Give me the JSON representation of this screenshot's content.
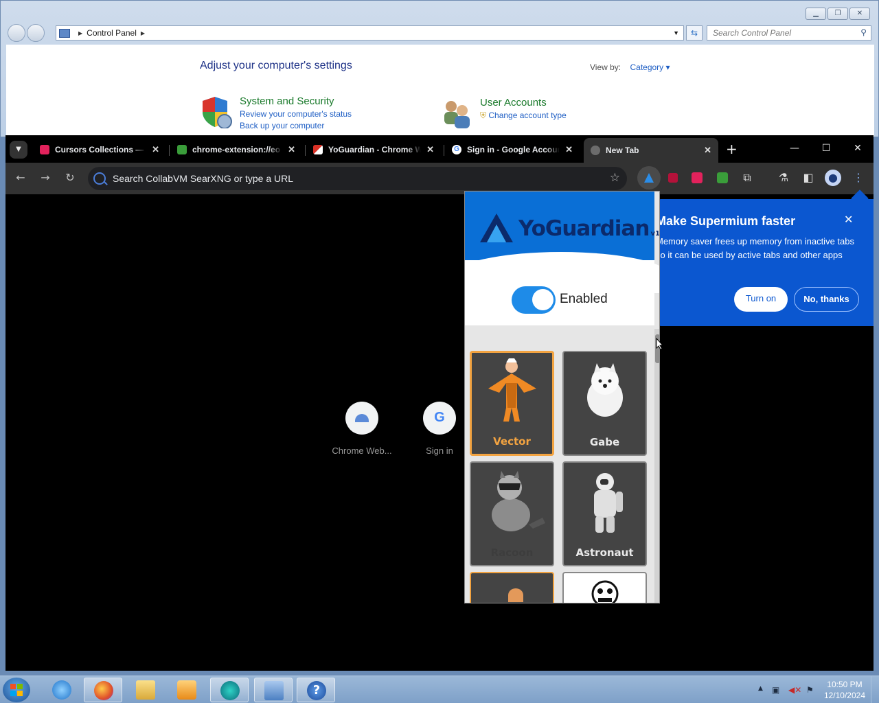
{
  "control_panel": {
    "breadcrumb": "Control Panel",
    "search_placeholder": "Search Control Panel",
    "heading": "Adjust your computer's settings",
    "view_by_label": "View by:",
    "view_by_value": "Category",
    "categories": [
      {
        "title": "System and Security",
        "links": [
          "Review your computer's status",
          "Back up your computer"
        ]
      },
      {
        "title": "User Accounts",
        "links": [
          "Change account type"
        ]
      }
    ]
  },
  "browser": {
    "tabs": [
      {
        "label": "Cursors Collections — C",
        "favicon_color": "#e2225c"
      },
      {
        "label": "chrome-extension://eo",
        "favicon_color": "#3a9d3a"
      },
      {
        "label": "YoGuardian - Chrome W",
        "favicon_color": "#d93025"
      },
      {
        "label": "Sign in - Google Accoun",
        "favicon_color": "#4285f4"
      },
      {
        "label": "New Tab",
        "favicon_color": "#6c6c6c",
        "active": true
      }
    ],
    "omnibox_placeholder": "Search CollabVM SearXNG or type a URL",
    "shortcuts": [
      {
        "name": "Chrome Web..."
      },
      {
        "name": "Sign in"
      }
    ]
  },
  "yoguardian": {
    "logo": "YoGuardian",
    "version": "v1",
    "toggle_label": "Enabled",
    "toggle_on": true,
    "cursors": [
      {
        "name": "Vector",
        "selected": true
      },
      {
        "name": "Gabe",
        "selected": false
      },
      {
        "name": "Racoon",
        "selected": false
      },
      {
        "name": "Astronaut",
        "selected": false
      }
    ]
  },
  "promo": {
    "title": "Make Supermium faster",
    "body": "Memory saver frees up memory from inactive tabs so it can be used by active tabs and other apps",
    "turn_on": "Turn on",
    "no_thanks": "No, thanks"
  },
  "taskbar": {
    "time": "10:50 PM",
    "date": "12/10/2024"
  },
  "colors": {
    "accent_blue": "#0b57d0",
    "yoguardian_blue": "#0a6fd6",
    "selected_orange": "#f2a341"
  }
}
